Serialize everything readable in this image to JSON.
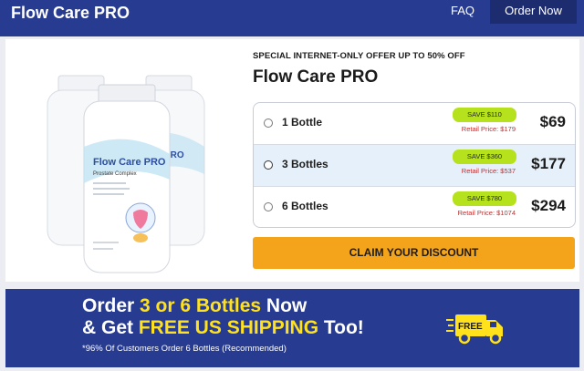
{
  "header": {
    "brand": "Flow Care PRO",
    "nav": {
      "faq": "FAQ",
      "order_now": "Order Now"
    }
  },
  "product": {
    "label_brand": "Flow Care PRO",
    "label_sub": "Prostate Complex"
  },
  "offer": {
    "headline": "SPECIAL INTERNET-ONLY OFFER UP TO 50% OFF",
    "title": "Flow Care PRO",
    "selected_index": 1,
    "options": [
      {
        "label": "1 Bottle",
        "save": "SAVE $110",
        "retail": "Retail Price: $179",
        "price": "$69"
      },
      {
        "label": "3 Bottles",
        "save": "SAVE $360",
        "retail": "Retail Price: $537",
        "price": "$177"
      },
      {
        "label": "6 Bottles",
        "save": "SAVE $780",
        "retail": "Retail Price: $1074",
        "price": "$294"
      }
    ],
    "cta": "CLAIM YOUR DISCOUNT"
  },
  "banner": {
    "line1_a": "Order ",
    "line1_hl": "3 or 6 Bottles",
    "line1_b": " Now",
    "line2_a": "& Get ",
    "line2_hl": "FREE US SHIPPING",
    "line2_b": " Too!",
    "footnote": "*96% Of Customers Order 6 Bottles (Recommended)",
    "truck_text": "FREE"
  },
  "colors": {
    "header_bg": "#273b91",
    "accent_yellow": "#ffe21b",
    "cta_orange": "#f4a41a",
    "save_badge": "#b5e21c",
    "retail_red": "#c42b2b"
  }
}
